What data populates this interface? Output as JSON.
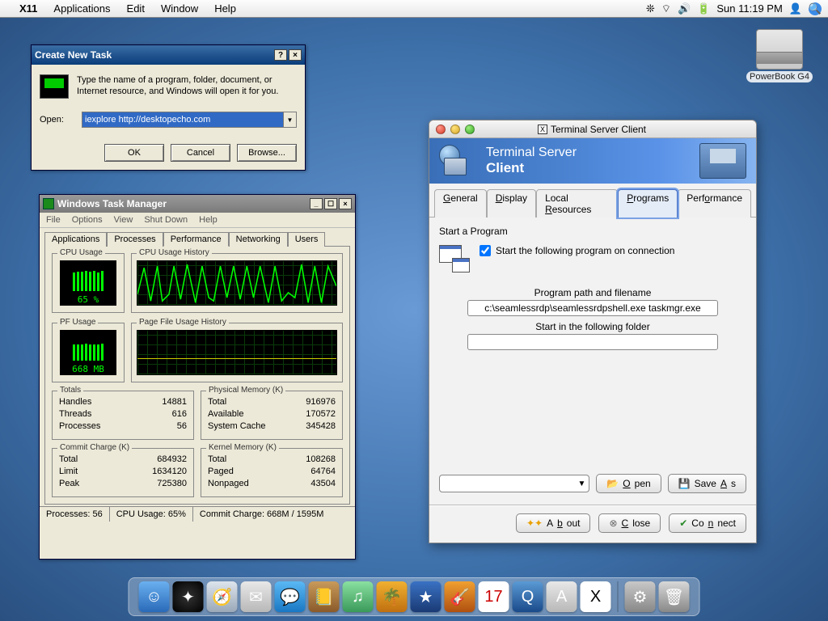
{
  "menubar": {
    "app": "X11",
    "items": [
      "Applications",
      "Edit",
      "Window",
      "Help"
    ],
    "clock": "Sun 11:19 PM"
  },
  "desktop": {
    "drive_label": "PowerBook G4"
  },
  "run": {
    "title": "Create New Task",
    "help_btn": "?",
    "close_btn": "×",
    "desc": "Type the name of a program, folder, document, or Internet resource, and Windows will open it for you.",
    "open_label": "Open:",
    "value": "iexplore http://desktopecho.com",
    "ok": "OK",
    "cancel": "Cancel",
    "browse": "Browse..."
  },
  "tm": {
    "title": "Windows Task Manager",
    "menu": [
      "File",
      "Options",
      "View",
      "Shut Down",
      "Help"
    ],
    "tabs": [
      "Applications",
      "Processes",
      "Performance",
      "Networking",
      "Users"
    ],
    "active_tab": "Performance",
    "cpu_label": "CPU Usage",
    "cpu_hist_label": "CPU Usage History",
    "cpu_value": "65 %",
    "pf_label": "PF Usage",
    "pf_hist_label": "Page File Usage History",
    "pf_value": "668 MB",
    "totals_label": "Totals",
    "totals": {
      "Handles": "14881",
      "Threads": "616",
      "Processes": "56"
    },
    "phys_label": "Physical Memory (K)",
    "phys": {
      "Total": "916976",
      "Available": "170572",
      "System Cache": "345428"
    },
    "commit_label": "Commit Charge (K)",
    "commit": {
      "Total": "684932",
      "Limit": "1634120",
      "Peak": "725380"
    },
    "kernel_label": "Kernel Memory (K)",
    "kernel": {
      "Total": "108268",
      "Paged": "64764",
      "Nonpaged": "43504"
    },
    "status": {
      "proc": "Processes: 56",
      "cpu": "CPU Usage: 65%",
      "commit": "Commit Charge: 668M / 1595M"
    }
  },
  "ts": {
    "win_title": "Terminal Server Client",
    "banner1": "Terminal Server",
    "banner2": "Client",
    "tabs": [
      {
        "pre": "",
        "u": "G",
        "post": "eneral"
      },
      {
        "pre": "",
        "u": "D",
        "post": "isplay"
      },
      {
        "pre": "Local ",
        "u": "R",
        "post": "esources"
      },
      {
        "pre": "",
        "u": "P",
        "post": "rograms"
      },
      {
        "pre": "Perf",
        "u": "o",
        "post": "rmance"
      }
    ],
    "active_tab": 3,
    "sap": "Start a Program",
    "cb_label": "Start the following program on connection",
    "cb_checked": true,
    "path_label": "Program path and filename",
    "path_value": "c:\\seamlessrdp\\seamlessrdpshell.exe taskmgr.exe",
    "folder_label": "Start in the following folder",
    "folder_value": "",
    "open": "Open",
    "saveas": "Save As",
    "about": "About",
    "close": "Close",
    "connect": "Connect"
  },
  "dock": {
    "items": [
      {
        "name": "finder",
        "bg": "linear-gradient(#6ab0f0,#2a6ab8)",
        "glyph": "☺"
      },
      {
        "name": "dashboard",
        "bg": "radial-gradient(circle,#333,#000)",
        "glyph": "✦"
      },
      {
        "name": "safari",
        "bg": "linear-gradient(#dde4ec,#9aa8b8)",
        "glyph": "🧭"
      },
      {
        "name": "mail",
        "bg": "linear-gradient(#e8e8e8,#b8b8b8)",
        "glyph": "✉"
      },
      {
        "name": "ichat",
        "bg": "linear-gradient(#5ab8f4,#1a78c4)",
        "glyph": "💬"
      },
      {
        "name": "addressbook",
        "bg": "linear-gradient(#c89a5a,#8a5a2a)",
        "glyph": "📒"
      },
      {
        "name": "itunes",
        "bg": "linear-gradient(#8ae0a0,#3a9a5a)",
        "glyph": "♫"
      },
      {
        "name": "iphoto",
        "bg": "linear-gradient(#f0b030,#c07010)",
        "glyph": "🌴"
      },
      {
        "name": "imovie",
        "bg": "linear-gradient(#3a72c4,#1a3a74)",
        "glyph": "★"
      },
      {
        "name": "garageband",
        "bg": "linear-gradient(#f0a030,#b05010)",
        "glyph": "🎸"
      },
      {
        "name": "ical",
        "bg": "#fff",
        "glyph": "17",
        "text": "#c00"
      },
      {
        "name": "quicktime",
        "bg": "linear-gradient(#5a9ad4,#1a4a8a)",
        "glyph": "Q"
      },
      {
        "name": "appleworks",
        "bg": "linear-gradient(#e8e8e8,#b8b8b8)",
        "glyph": "A"
      },
      {
        "name": "x11",
        "bg": "#fff",
        "glyph": "X",
        "text": "#000"
      }
    ],
    "right": [
      {
        "name": "system-preferences",
        "bg": "linear-gradient(#c8c8c8,#888)",
        "glyph": "⚙"
      },
      {
        "name": "trash",
        "bg": "linear-gradient(#d8d8d8,#888)",
        "glyph": "🗑"
      }
    ]
  }
}
